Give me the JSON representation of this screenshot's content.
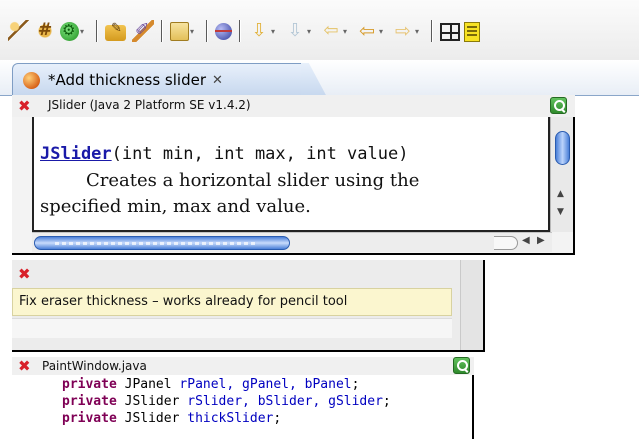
{
  "toolbar": {
    "buttons": [
      {
        "name": "new-package-icon",
        "dropdown": false
      },
      {
        "name": "new-class-icon",
        "dropdown": false
      },
      {
        "name": "run-icon",
        "dropdown": true
      },
      {
        "name": "open-folder-icon",
        "dropdown": false
      },
      {
        "name": "edit-pen-icon",
        "dropdown": false
      },
      {
        "name": "paste-icon",
        "dropdown": true
      },
      {
        "name": "globe-icon",
        "dropdown": false
      },
      {
        "name": "next-annotation-icon",
        "dropdown": true
      },
      {
        "name": "prev-annotation-icon",
        "dropdown": true
      },
      {
        "name": "last-edit-icon",
        "dropdown": true
      },
      {
        "name": "back-arrow-icon",
        "dropdown": true
      },
      {
        "name": "forward-arrow-icon",
        "dropdown": true
      },
      {
        "name": "perspective-icon",
        "dropdown": false
      },
      {
        "name": "task-list-icon",
        "dropdown": false
      }
    ],
    "dropdown_glyph": "▾"
  },
  "editor": {
    "tab_label": "*Add thickness slider",
    "tab_close": "✕"
  },
  "javadoc_popup": {
    "title": "JSlider (Java 2 Platform SE v1.4.2)",
    "close_glyph": "✖",
    "signature_link": "JSlider",
    "signature_rest": "(int min, int max, int value)",
    "description_line1": "Creates a horizontal slider using the",
    "description_line2": "specified min, max and value.",
    "scroll_up": "▲",
    "scroll_down": "▼",
    "scroll_left": "◀",
    "scroll_right": "▶"
  },
  "task_popup": {
    "close_glyph": "✖",
    "task_text": "Fix eraser thickness – works already for pencil tool"
  },
  "code_popup": {
    "title": "PaintWindow.java",
    "close_glyph": "✖",
    "lines": [
      {
        "keyword": "private",
        "type": "JPanel",
        "fields": "rPanel, gPanel, bPanel",
        "end": ";"
      },
      {
        "keyword": "private",
        "type": "JSlider",
        "fields": "rSlider, bSlider, gSlider",
        "end": ";"
      },
      {
        "keyword": "private",
        "type": "JSlider",
        "fields": "thickSlider",
        "end": ";"
      }
    ]
  },
  "colors": {
    "close_red": "#d8202a",
    "keyword": "#7f0055",
    "field": "#0000c0",
    "link": "#1a1aa8",
    "task_bg": "#fbf6cf"
  }
}
